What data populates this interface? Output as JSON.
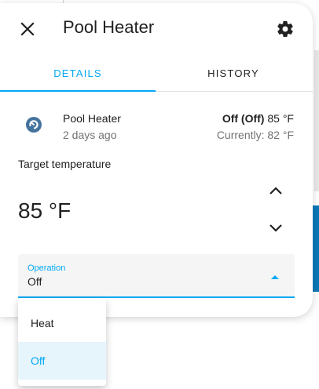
{
  "dialog": {
    "title": "Pool Heater",
    "close_icon": "close-icon",
    "settings_icon": "gear-icon"
  },
  "tabs": [
    {
      "label": "DETAILS",
      "active": true
    },
    {
      "label": "HISTORY",
      "active": false
    }
  ],
  "entity": {
    "name": "Pool Heater",
    "last_changed": "2 days ago",
    "icon": "pool-heater-icon",
    "state_bold": "Off (Off)",
    "state_temp": "85 °F",
    "current": "Currently: 82 °F"
  },
  "target": {
    "label": "Target temperature",
    "value": "85 °F",
    "up_icon": "chevron-up-icon",
    "down_icon": "chevron-down-icon"
  },
  "operation": {
    "label": "Operation",
    "value": "Off",
    "options": [
      {
        "label": "Heat",
        "selected": false
      },
      {
        "label": "Off",
        "selected": true
      }
    ]
  },
  "colors": {
    "accent": "#03a9f4",
    "text": "#212121",
    "secondary_text": "#727272",
    "icon": "#44739e"
  }
}
